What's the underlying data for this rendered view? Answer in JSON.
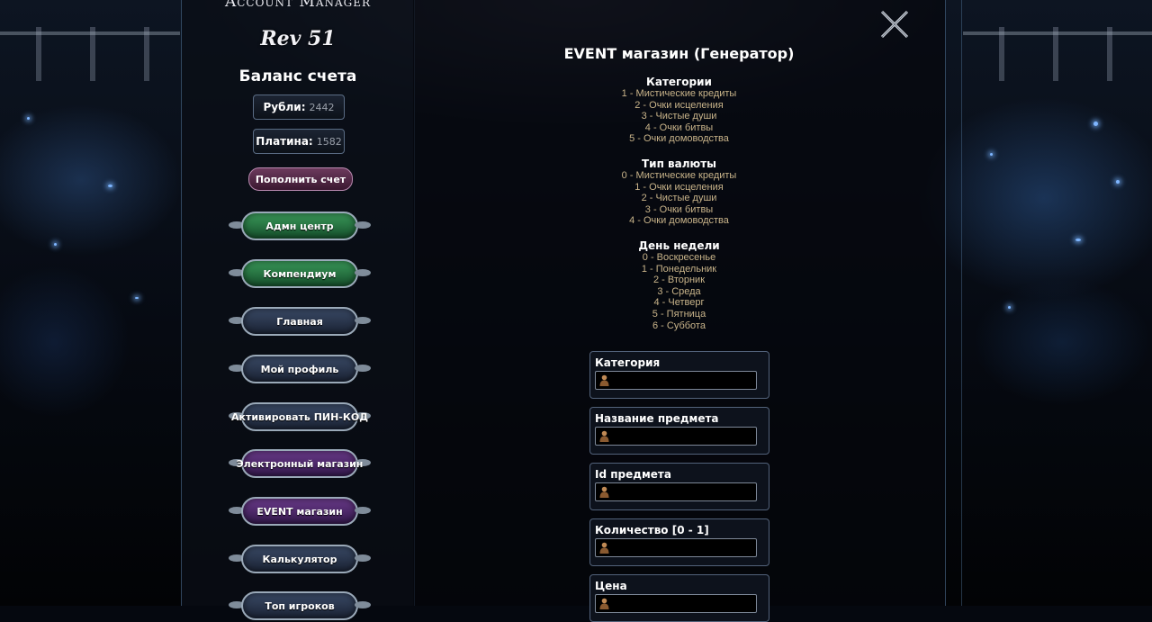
{
  "brand": {
    "logo_text": "Account   Manager",
    "rev_text": "Rev 51"
  },
  "sidebar": {
    "balance_title": "Баланс счета",
    "rubles_label": "Рубли:",
    "rubles_value": "2442",
    "platinum_label": "Платина:",
    "platinum_value": "1582",
    "topup_label": "Пополнить счет",
    "nav": [
      {
        "label": "Адмн центр",
        "style": "green"
      },
      {
        "label": "Компендиум",
        "style": "green"
      },
      {
        "label": "Главная",
        "style": "blue"
      },
      {
        "label": "Мой профиль",
        "style": "blue"
      },
      {
        "label": "Активировать ПИН-КОД",
        "style": "blue"
      },
      {
        "label": "Электронный магазин",
        "style": "purple"
      },
      {
        "label": "EVENT магазин",
        "style": "purple"
      },
      {
        "label": "Калькулятор",
        "style": "blue"
      },
      {
        "label": "Топ игроков",
        "style": "blue"
      }
    ]
  },
  "main": {
    "title": "EVENT магазин (Генератор)",
    "categories": {
      "heading": "Категории",
      "items": [
        "1 - Мистические кредиты",
        "2 - Очки исцеления",
        "3 - Чистые души",
        "4 - Очки битвы",
        "5 - Очки домоводства"
      ]
    },
    "currency": {
      "heading": "Тип валюты",
      "items": [
        "0 - Мистические кредиты",
        "1 - Очки исцеления",
        "2 - Чистые души",
        "3 - Очки битвы",
        "4 - Очки домоводства"
      ]
    },
    "weekday": {
      "heading": "День недели",
      "items": [
        "0 - Воскресенье",
        "1 - Понедельник",
        "2 - Вторник",
        "3 - Среда",
        "4 - Четверг",
        "5 - Пятница",
        "6 - Суббота"
      ]
    },
    "fields": [
      {
        "label": "Категория",
        "value": ""
      },
      {
        "label": "Название предмета",
        "value": ""
      },
      {
        "label": "Id предмета",
        "value": ""
      },
      {
        "label": "Количество [0 - 1]",
        "value": ""
      },
      {
        "label": "Цена",
        "value": ""
      }
    ]
  },
  "colors": {
    "info_text": "#c9b48a",
    "heading": "#ffffff",
    "accent_blue": "#7fb6ff"
  },
  "icons": {
    "close": "crossed-swords-close-icon",
    "field": "user-icon"
  }
}
